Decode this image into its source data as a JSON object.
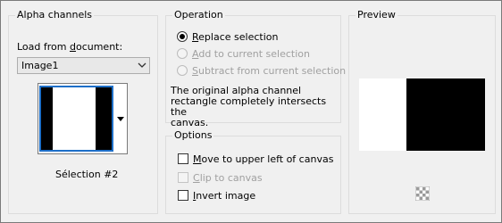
{
  "alpha": {
    "title": "Alpha channels",
    "load_from_document": "Load from document:",
    "document_value": "Image1",
    "selection_name": "Sélection #2"
  },
  "operation": {
    "title": "Operation",
    "options": [
      {
        "label": "Replace selection",
        "selected": true,
        "enabled": true
      },
      {
        "label": "Add to current selection",
        "selected": false,
        "enabled": false
      },
      {
        "label": "Subtract from current selection",
        "selected": false,
        "enabled": false
      }
    ],
    "description": [
      "The original alpha channel",
      "rectangle completely intersects the",
      "canvas."
    ]
  },
  "options": {
    "title": "Options",
    "items": [
      {
        "label": "Move to upper left of canvas",
        "checked": false,
        "enabled": true
      },
      {
        "label": "Clip to canvas",
        "checked": false,
        "enabled": false
      },
      {
        "label": "Invert image",
        "checked": false,
        "enabled": true
      }
    ]
  },
  "preview": {
    "title": "Preview"
  },
  "icons": {
    "combo_arrow": "chevron-down-icon",
    "dropdown": "triangle-down-icon",
    "background": "checkerboard-icon"
  }
}
